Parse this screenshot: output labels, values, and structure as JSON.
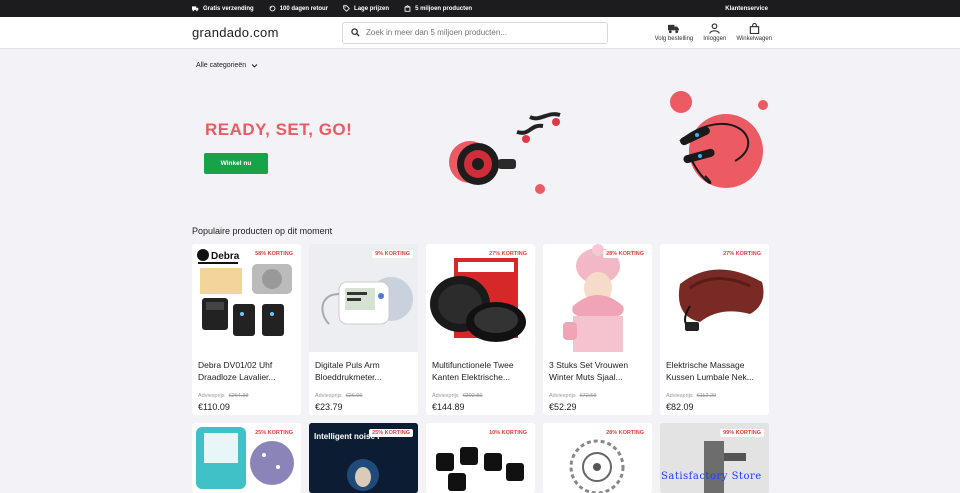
{
  "topbar": {
    "usps": [
      {
        "icon": "truck-icon",
        "label": "Gratis verzending"
      },
      {
        "icon": "return-icon",
        "label": "100 dagen retour"
      },
      {
        "icon": "tag-icon",
        "label": "Lage prijzen"
      },
      {
        "icon": "box-icon",
        "label": "5 miljoen producten"
      }
    ],
    "service": "Klantenservice"
  },
  "header": {
    "logo": "grandado.com",
    "search_placeholder": "Zoek in meer dan 5 miljoen producten...",
    "icons": [
      {
        "icon": "truck-icon",
        "label": "Volg bestelling"
      },
      {
        "icon": "user-icon",
        "label": "Inloggen"
      },
      {
        "icon": "cart-icon",
        "label": "Winkelwagen"
      }
    ]
  },
  "categories": {
    "label": "Alle categorieën"
  },
  "hero": {
    "title": "READY, SET, GO!",
    "cta": "Winkel nu"
  },
  "section": {
    "title": "Populaire producten op dit moment"
  },
  "products": [
    {
      "badge": "58% KORTING",
      "name": "Debra DV01/02 Uhf Draadloze Lavalier...",
      "old_label": "Adviesprijs",
      "old_price": "€264.39",
      "price": "€110.09",
      "brand": "Debra"
    },
    {
      "badge": "9% KORTING",
      "name": "Digitale Puls Arm Bloeddrukmeter...",
      "old_label": "Adviesprijs",
      "old_price": "€26.09",
      "price": "€23.79"
    },
    {
      "badge": "27% KORTING",
      "name": "Multifunctionele Twee Kanten Elektrische...",
      "old_label": "Adviesprijs",
      "old_price": "€202.59",
      "price": "€144.89"
    },
    {
      "badge": "28% KORTING",
      "name": "3 Stuks Set Vrouwen Winter Muts Sjaal...",
      "old_label": "Adviesprijs",
      "old_price": "€72.59",
      "price": "€52.29"
    },
    {
      "badge": "27% KORTING",
      "name": "Elektrische Massage Kussen Lumbale Nek...",
      "old_label": "Adviesprijs",
      "old_price": "€112.29",
      "price": "€82.09"
    }
  ],
  "products_row2": [
    {
      "badge": "25% KORTING"
    },
    {
      "badge": "25% KORTING",
      "overlay": "Intelligent noise r"
    },
    {
      "badge": "10% KORTING"
    },
    {
      "badge": "28% KORTING"
    },
    {
      "badge": "99% KORTING"
    }
  ],
  "watermark": "Satisfactory Store"
}
